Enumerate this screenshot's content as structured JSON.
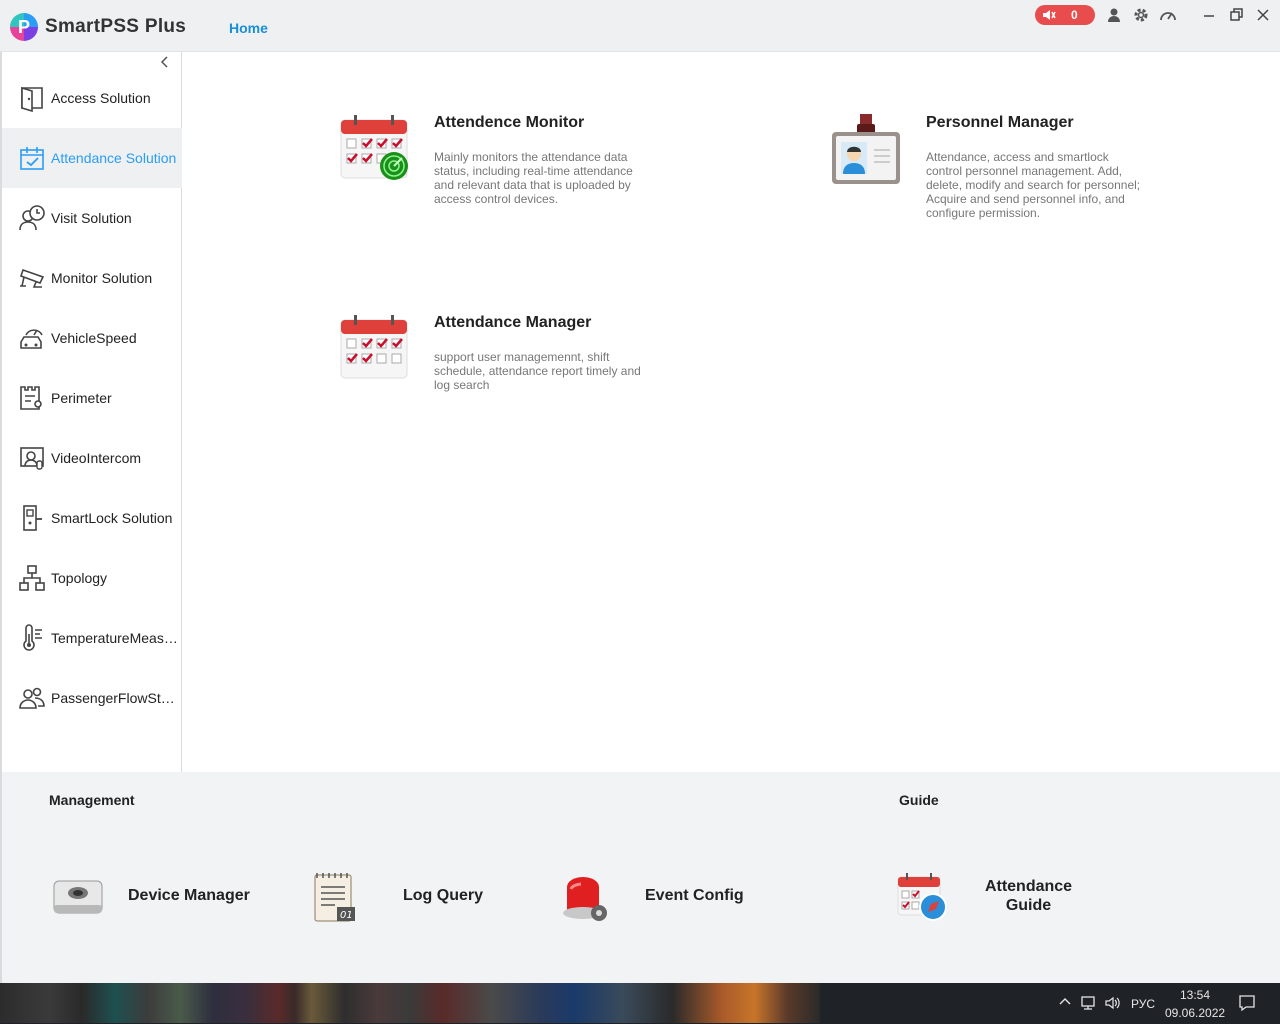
{
  "app": {
    "title": "SmartPSS Plus",
    "nav_home": "Home",
    "alarm_count": "0",
    "accent": "#2a9df4"
  },
  "sidebar": {
    "items": [
      {
        "label": "Access Solution",
        "icon": "door-icon"
      },
      {
        "label": "Attendance Solution",
        "icon": "calendar-check-icon",
        "active": true
      },
      {
        "label": "Visit Solution",
        "icon": "visitor-clock-icon"
      },
      {
        "label": "Monitor Solution",
        "icon": "cctv-camera-icon"
      },
      {
        "label": "VehicleSpeed",
        "icon": "car-speed-icon"
      },
      {
        "label": "Perimeter",
        "icon": "perimeter-icon"
      },
      {
        "label": "VideoIntercom",
        "icon": "intercom-icon"
      },
      {
        "label": "SmartLock Solution",
        "icon": "smartlock-icon"
      },
      {
        "label": "Topology",
        "icon": "topology-icon"
      },
      {
        "label": "TemperatureMeas…",
        "icon": "thermometer-icon"
      },
      {
        "label": "PassengerFlowSt…",
        "icon": "people-icon"
      }
    ]
  },
  "main": {
    "cards": [
      {
        "title": "Attendence Monitor",
        "desc": "Mainly monitors the attendance data status, including real-time attendance and relevant data that is uploaded by access control devices."
      },
      {
        "title": "Personnel Manager",
        "desc": "Attendance,  access and smartlock control personnel management.  Add, delete, modify and search for personnel; Acquire and send personnel info, and configure permission."
      },
      {
        "title": "Attendance Manager",
        "desc": "support user managemennt, shift schedule, attendance report timely and log search"
      }
    ]
  },
  "management": {
    "title": "Management",
    "tools": [
      {
        "label": "Device Manager"
      },
      {
        "label": "Log Query"
      },
      {
        "label": "Event Config"
      }
    ]
  },
  "guide": {
    "title": "Guide",
    "tools": [
      {
        "label": "Attendance Guide"
      }
    ]
  },
  "taskbar": {
    "lang": "РУС",
    "time": "13:54",
    "date": "09.06.2022"
  }
}
